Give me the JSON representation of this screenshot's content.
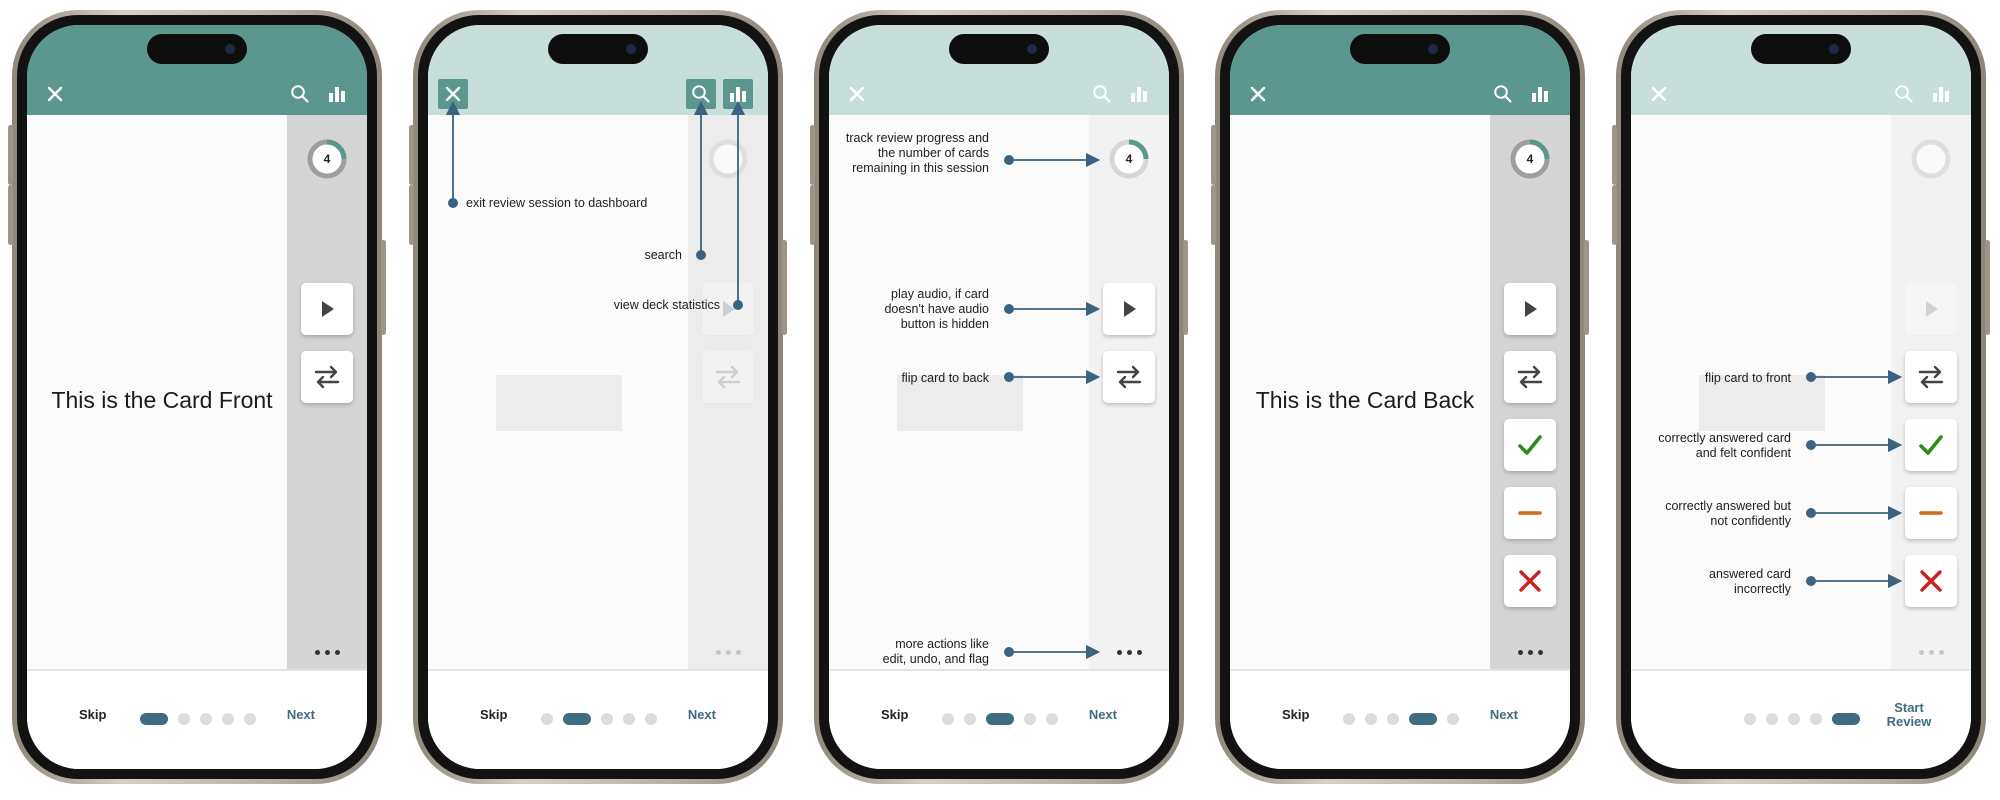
{
  "colors": {
    "header": "#5b978f",
    "header_dim": "#c7dedb",
    "accent_blue": "#3f6c82",
    "check_green": "#2d8a1e",
    "dash_orange": "#d06a1c",
    "cross_red": "#cc1f1f"
  },
  "icons": [
    "close-icon",
    "search-icon",
    "stats-icon",
    "play-icon",
    "flip-icon",
    "check-icon",
    "dash-icon",
    "cross-icon",
    "more-icon"
  ],
  "screens": [
    {
      "card_text": "This is the Card Front",
      "progress_count": "4",
      "footer": {
        "skip": "Skip",
        "next": "Next",
        "active_step": 1,
        "total_steps": 5
      }
    },
    {
      "annotations": {
        "exit": "exit review session to dashboard",
        "search": "search",
        "stats": "view deck statistics"
      },
      "footer": {
        "skip": "Skip",
        "next": "Next",
        "active_step": 2,
        "total_steps": 5
      }
    },
    {
      "progress_count": "4",
      "annotations": {
        "progress": "track review progress and the number of cards remaining in this session",
        "audio": "play audio, if card doesn't have audio button is hidden",
        "flip": "flip card to back",
        "more": "more actions like edit, undo, and flag"
      },
      "footer": {
        "skip": "Skip",
        "next": "Next",
        "active_step": 3,
        "total_steps": 5
      }
    },
    {
      "card_text": "This is the Card Back",
      "progress_count": "4",
      "footer": {
        "skip": "Skip",
        "next": "Next",
        "active_step": 4,
        "total_steps": 5
      }
    },
    {
      "annotations": {
        "flip_front": "flip card to front",
        "correct_confident": "correctly answered card and felt confident",
        "correct_unsure": "correctly answered but not confidently",
        "incorrect": "answered card incorrectly"
      },
      "footer": {
        "start_review": "Start Review",
        "active_step": 5,
        "total_steps": 5
      }
    }
  ]
}
